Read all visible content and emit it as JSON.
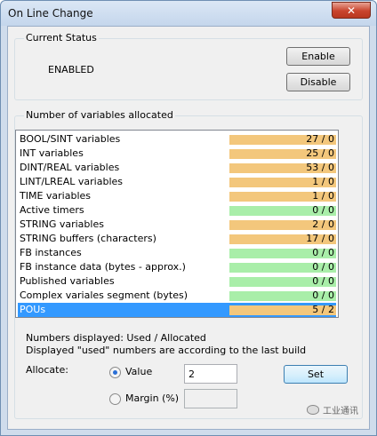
{
  "window": {
    "title": "On Line Change",
    "close_glyph": "✕"
  },
  "current_status": {
    "legend": "Current Status",
    "status_text": "ENABLED",
    "enable_label": "Enable",
    "disable_label": "Disable"
  },
  "variables": {
    "legend": "Number of variables allocated",
    "colors": {
      "used_bar": "#f3c77c",
      "free_bar": "#a9eea9",
      "selected_row": "#3399ff"
    },
    "rows": [
      {
        "name": "BOOL/SINT variables",
        "value": "27 / 0",
        "bar_color": "#f3c77c"
      },
      {
        "name": "INT variables",
        "value": "25 / 0",
        "bar_color": "#f3c77c"
      },
      {
        "name": "DINT/REAL variables",
        "value": "53 / 0",
        "bar_color": "#f3c77c"
      },
      {
        "name": "LINT/LREAL variables",
        "value": "1 / 0",
        "bar_color": "#f3c77c"
      },
      {
        "name": "TIME variables",
        "value": "1 / 0",
        "bar_color": "#f3c77c"
      },
      {
        "name": "Active timers",
        "value": "0 / 0",
        "bar_color": "#a9eea9"
      },
      {
        "name": "STRING variables",
        "value": "2 / 0",
        "bar_color": "#f3c77c"
      },
      {
        "name": "STRING buffers (characters)",
        "value": "17 / 0",
        "bar_color": "#f3c77c"
      },
      {
        "name": "FB instances",
        "value": "0 / 0",
        "bar_color": "#a9eea9"
      },
      {
        "name": "FB instance data (bytes - approx.)",
        "value": "0 / 0",
        "bar_color": "#a9eea9"
      },
      {
        "name": "Published variables",
        "value": "0 / 0",
        "bar_color": "#a9eea9"
      },
      {
        "name": "Complex variales segment (bytes)",
        "value": "0 / 0",
        "bar_color": "#a9eea9"
      },
      {
        "name": "POUs",
        "value": "5 / 2",
        "bar_color": "#f3c77c",
        "selected": true
      }
    ],
    "note_line1": "Numbers displayed: Used / Allocated",
    "note_line2": "Displayed \"used\" numbers are according to the last build",
    "allocate_label": "Allocate:",
    "value_radio_label": "Value",
    "value_input": "2",
    "margin_radio_label": "Margin (%)",
    "margin_input": "",
    "set_label": "Set"
  },
  "watermark": {
    "text": "工业通讯"
  }
}
